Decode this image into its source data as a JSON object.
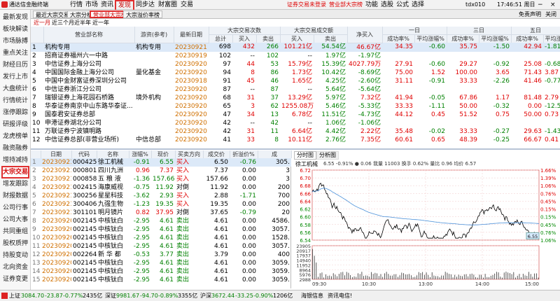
{
  "titlebar": {
    "app_name": "通达信金融终端",
    "menus": [
      "行情",
      "市场",
      "资讯",
      "发现",
      "同步达",
      "财富圈",
      "交易"
    ],
    "active_menu": "发现",
    "warning": "证券交易未登录",
    "warning2": "营业部大宗榜",
    "tools": [
      "功能",
      "选股",
      "公式",
      "选择"
    ],
    "account": "tdx010",
    "time": "17:46:51 周日"
  },
  "sidebar": {
    "items": [
      "最新发现",
      "板块解读",
      "市场脉搏",
      "重点关注",
      "财经日历",
      "发行上市",
      "大盘统计",
      "行情统计",
      "涨停跟踪",
      "研报评级",
      "龙虎榜单",
      "融资融券",
      "增持减持",
      "大宗交易",
      "增发跟踪",
      "财报数据",
      "公司行事",
      "公司大事",
      "共同重组",
      "股权质押",
      "持股变动",
      "北向资金",
      "证券变更"
    ],
    "active": "大宗交易"
  },
  "tabs": {
    "items": [
      "最近大宗交易",
      "大宗分析",
      "营业部大宗榜",
      "大宗溢价率榜"
    ],
    "active": "营业部大宗榜",
    "right": [
      "免责声明",
      "关闭"
    ]
  },
  "periods": {
    "items": [
      "近一月",
      "近三个月",
      "近半年",
      "近一年"
    ],
    "active": "近一月"
  },
  "top_table": {
    "headers": {
      "name": "营业部名称",
      "tag": "游资(参考)",
      "date": "最新日期",
      "group_count": "大宗交易次数",
      "group_amount": "大宗交易成交额",
      "net": "净买入",
      "group1": "一日",
      "group3": "三日",
      "group5": "五日",
      "sub_total": "总计",
      "sub_buy": "买入",
      "sub_sell": "卖出",
      "sub_rate": "成功率%",
      "sub_avg": "平均涨幅%"
    },
    "rows": [
      {
        "n": "1",
        "name": "机构专用",
        "tag": "机构专用",
        "date": "20230921",
        "c_total": "698",
        "c_buy": "432",
        "c_sell": "266",
        "a_buy": "101.21亿",
        "a_sell": "54.54亿",
        "net": "46.67亿",
        "r1": "34.35",
        "p1": "-0.60",
        "r3": "35.75",
        "p3": "-1.50",
        "r5": "42.94",
        "p5": "-1.81"
      },
      {
        "n": "2",
        "name": "招商证券福州六一中路",
        "tag": "",
        "date": "20230919",
        "c_total": "102",
        "c_buy": "--",
        "c_sell": "102",
        "a_buy": "--",
        "a_sell": "1.97亿",
        "net": "-1.97亿",
        "r1": "",
        "p1": "",
        "r3": "",
        "p3": "",
        "r5": "",
        "p5": ""
      },
      {
        "n": "3",
        "name": "中信证券上海分公司",
        "tag": "",
        "date": "20230920",
        "c_total": "97",
        "c_buy": "44",
        "c_sell": "53",
        "a_buy": "15.79亿",
        "a_sell": "15.39亿",
        "net": "4027.79万",
        "r1": "27.91",
        "p1": "-0.60",
        "r3": "29.27",
        "p3": "-0.92",
        "r5": "25.08",
        "p5": "-0.68"
      },
      {
        "n": "4",
        "name": "中国国际金融上海分公司",
        "tag": "量化基金",
        "date": "20230920",
        "c_total": "94",
        "c_buy": "8",
        "c_sell": "86",
        "a_buy": "1.73亿",
        "a_sell": "10.42亿",
        "net": "-8.69亿",
        "r1": "75.00",
        "p1": "1.52",
        "r3": "100.00",
        "p3": "3.65",
        "r5": "71.43",
        "p5": "3.87"
      },
      {
        "n": "5",
        "name": "中国中金财富证券深圳分公司",
        "tag": "",
        "date": "20230918",
        "c_total": "91",
        "c_buy": "45",
        "c_sell": "46",
        "a_buy": "1.65亿",
        "a_sell": "4.25亿",
        "net": "-2.60亿",
        "r1": "31.11",
        "p1": "-0.91",
        "r3": "33.33",
        "p3": "-2.26",
        "r5": "41.46",
        "p5": "-0.77"
      },
      {
        "n": "6",
        "name": "中信证券浙江分公司",
        "tag": "",
        "date": "20230920",
        "c_total": "87",
        "c_buy": "--",
        "c_sell": "87",
        "a_buy": "--",
        "a_sell": "5.64亿",
        "net": "-5.64亿",
        "r1": "",
        "p1": "",
        "r3": "",
        "p3": "",
        "r5": "",
        "p5": ""
      },
      {
        "n": "7",
        "name": "瑞银证券上海花园石桥路",
        "tag": "境外机构",
        "date": "20230920",
        "c_total": "68",
        "c_buy": "31",
        "c_sell": "37",
        "a_buy": "13.29亿",
        "a_sell": "5.97亿",
        "net": "7.32亿",
        "r1": "41.94",
        "p1": "-0.05",
        "r3": "67.86",
        "p3": "1.17",
        "r5": "81.48",
        "p5": "2.79"
      },
      {
        "n": "8",
        "name": "华泰证券南京中山东路华泰证...",
        "tag": "",
        "date": "20230920",
        "c_total": "65",
        "c_buy": "3",
        "c_sell": "62",
        "a_buy": "1255.08万",
        "a_sell": "5.46亿",
        "net": "-5.33亿",
        "r1": "33.33",
        "p1": "-1.11",
        "r3": "50.00",
        "p3": "-0.32",
        "r5": "0.00",
        "p5": "-12.54"
      },
      {
        "n": "9",
        "name": "国泰君安证券总部",
        "tag": "",
        "date": "20230920",
        "c_total": "47",
        "c_buy": "34",
        "c_sell": "13",
        "a_buy": "6.78亿",
        "a_sell": "11.51亿",
        "net": "-4.73亿",
        "r1": "44.12",
        "p1": "0.45",
        "r3": "51.52",
        "p3": "0.75",
        "r5": "50.00",
        "p5": "0.73"
      },
      {
        "n": "10",
        "name": "申港证券湖北分公司",
        "tag": "",
        "date": "20230920",
        "c_total": "42",
        "c_buy": "--",
        "c_sell": "42",
        "a_buy": "--",
        "a_sell": "1.06亿",
        "net": "-1.06亿",
        "r1": "",
        "p1": "",
        "r3": "",
        "p3": "",
        "r5": "",
        "p5": ""
      },
      {
        "n": "11",
        "name": "万联证券宁波镇明路",
        "tag": "",
        "date": "20230920",
        "c_total": "42",
        "c_buy": "31",
        "c_sell": "11",
        "a_buy": "6.64亿",
        "a_sell": "4.42亿",
        "net": "2.22亿",
        "r1": "35.48",
        "p1": "-0.02",
        "r3": "33.33",
        "p3": "-0.27",
        "r5": "29.63",
        "p5": "-1.43"
      },
      {
        "n": "12",
        "name": "中信证券总部(非营业场所)",
        "tag": "中信总部",
        "date": "20230920",
        "c_total": "41",
        "c_buy": "33",
        "c_sell": "8",
        "a_buy": "10.11亿",
        "a_sell": "2.76亿",
        "net": "7.35亿",
        "r1": "60.61",
        "p1": "0.65",
        "r3": "48.39",
        "p3": "-0.25",
        "r5": "66.67",
        "p5": "0.41"
      }
    ]
  },
  "bottom_table": {
    "headers": [
      "日期",
      "代码",
      "名称",
      "涨幅%",
      "现价",
      "买卖方向",
      "成交价",
      "折溢价%",
      "成"
    ],
    "rows": [
      {
        "d": "20230921",
        "code": "000425",
        "name": "徐工机械",
        "chg": "-0.91",
        "price": "6.55",
        "dir": "买入",
        "deal": "6.50",
        "prem": "-0.76",
        "vol": "305."
      },
      {
        "d": "20230921",
        "code": "000801",
        "name": "四川九洲",
        "chg": "0.96",
        "price": "7.37",
        "dir": "买入",
        "deal": "7.37",
        "prem": "0.00",
        "vol": "3"
      },
      {
        "d": "20230921",
        "code": "000858",
        "name": "五 粮 液",
        "chg": "-1.36",
        "price": "157.66",
        "dir": "买入",
        "deal": "157.66",
        "prem": "0.00",
        "vol": "3"
      },
      {
        "d": "20230921",
        "code": "002415",
        "name": "海康威视",
        "chg": "-0.75",
        "price": "11.92",
        "dir": "对倒",
        "deal": "11.92",
        "prem": "0.00",
        "vol": "200"
      },
      {
        "d": "20230921",
        "code": "300256",
        "name": "星星科技",
        "chg": "-3.62",
        "price": "2.93",
        "dir": "买入",
        "deal": "2.88",
        "prem": "-1.71",
        "vol": "700"
      },
      {
        "d": "20230921",
        "code": "300406",
        "name": "九强生物",
        "chg": "-1.23",
        "price": "19.35",
        "dir": "买入",
        "deal": "19.35",
        "prem": "0.00",
        "vol": "200"
      },
      {
        "d": "20230921",
        "code": "301101",
        "name": "明月镜片",
        "chg": "0.82",
        "price": "37.95",
        "dir": "对倒",
        "deal": "37.65",
        "prem": "-0.79",
        "vol": "20"
      },
      {
        "d": "20230920",
        "code": "002145",
        "name": "中核钛白",
        "chg": "-2.95",
        "price": "4.61",
        "dir": "卖出",
        "deal": "4.61",
        "prem": "0.00",
        "vol": "4586."
      },
      {
        "d": "20230920",
        "code": "002145",
        "name": "中核钛白",
        "chg": "-2.95",
        "price": "4.61",
        "dir": "卖出",
        "deal": "4.61",
        "prem": "0.00",
        "vol": "3057."
      },
      {
        "d": "20230920",
        "code": "002145",
        "name": "中核钛白",
        "chg": "-2.95",
        "price": "4.61",
        "dir": "卖出",
        "deal": "4.61",
        "prem": "0.00",
        "vol": "1528."
      },
      {
        "d": "20230920",
        "code": "002145",
        "name": "中核钛白",
        "chg": "-2.95",
        "price": "4.61",
        "dir": "卖出",
        "deal": "4.61",
        "prem": "0.00",
        "vol": "3057."
      },
      {
        "d": "20230920",
        "code": "002264",
        "name": "新 华 都",
        "chg": "-0.53",
        "price": "3.77",
        "dir": "卖出",
        "deal": "3.79",
        "prem": "0.00",
        "vol": "400"
      },
      {
        "d": "20230920",
        "code": "002145",
        "name": "中核钛白",
        "chg": "-2.95",
        "price": "4.61",
        "dir": "卖出",
        "deal": "4.61",
        "prem": "0.00",
        "vol": "3059."
      },
      {
        "d": "20230920",
        "code": "002145",
        "name": "中核钛白",
        "chg": "-2.95",
        "price": "4.61",
        "dir": "卖出",
        "deal": "4.61",
        "prem": "0.00",
        "vol": "3059."
      },
      {
        "d": "20230920",
        "code": "002145",
        "name": "中核钛白",
        "chg": "-2.95",
        "price": "4.61",
        "dir": "卖出",
        "deal": "4.61",
        "prem": "0.00",
        "vol": "3059."
      }
    ]
  },
  "chart": {
    "tabs": [
      "分时图",
      "分析图"
    ],
    "active_tab": "分时图",
    "stock": "徐工机械",
    "info": "6.55 -0.91% ● 0.06 我量 11003 换手 0.62% 量比 0.96 均价 6.57",
    "price_labels": [
      "6.72",
      "6.70",
      "6.68",
      "6.66",
      "6.64",
      "6.62",
      "6.60",
      "6.58",
      "6.56",
      "6.54"
    ],
    "pct_labels": [
      "1.66%",
      "1.39%",
      "1.06%",
      "0.76%",
      "0.45%",
      "0.15%",
      "0.15%",
      "0.45%",
      "0.76%",
      "1.06%"
    ],
    "current_price": "6.55",
    "vol_labels": [
      "23905",
      "20917",
      "17937",
      "14940",
      "11952",
      "8964",
      "5976",
      "2988"
    ],
    "time_labels": [
      "09:30",
      "10:30",
      "13:00",
      "14:00",
      "15:00"
    ],
    "colors": {
      "price_line": "#000000",
      "avg_line": "#4a90d9",
      "vol_bar": "#333333"
    }
  },
  "statusbar": {
    "items": [
      {
        "label": "上证",
        "val": "3084.70",
        "chg": "-23.87",
        "pct": "-0.77%",
        "amt": "2435亿"
      },
      {
        "label": "深证",
        "val": "9981.67",
        "chg": "-94.70",
        "pct": "-0.89%",
        "amt": "3355亿"
      },
      {
        "label": "沪深",
        "val": "3672.44",
        "chg": "-33.25",
        "pct": "-0.90%",
        "amt": "1206亿"
      }
    ],
    "extra": [
      "海银信息",
      "资讯电信!"
    ]
  }
}
